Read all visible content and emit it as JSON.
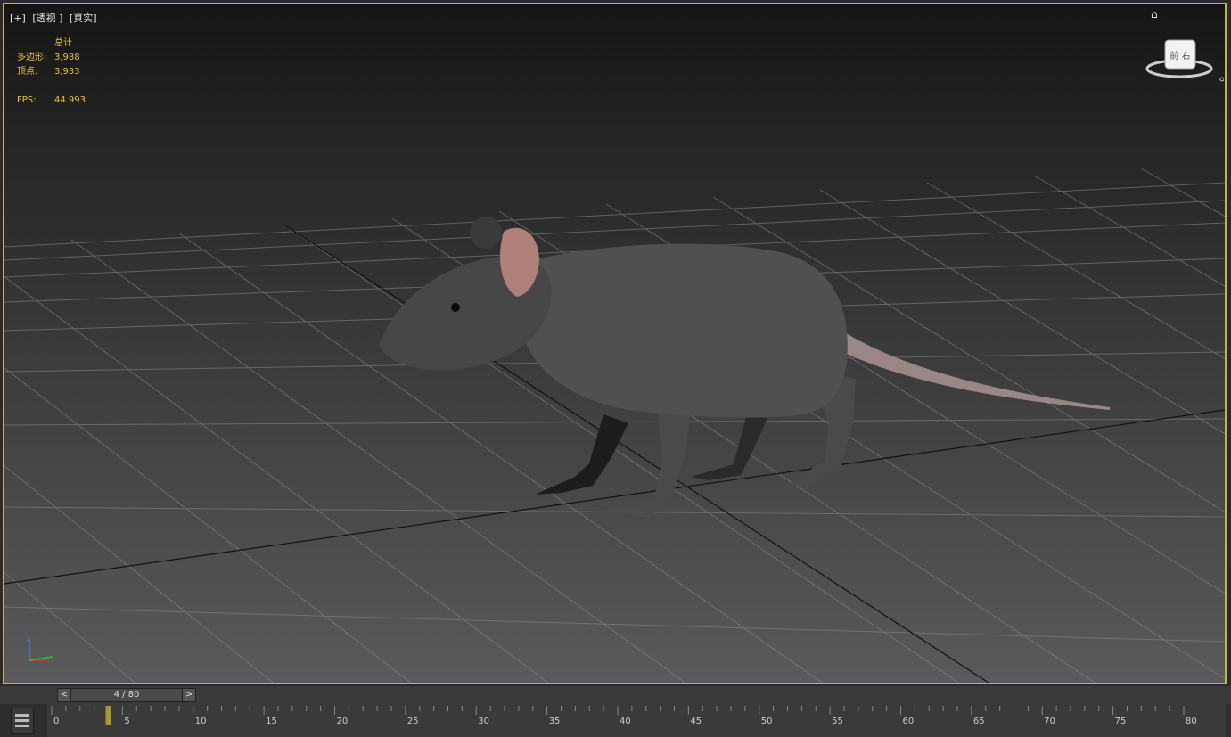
{
  "viewport": {
    "label_plus": "[+]",
    "label_view": "[透视 ]",
    "label_shading": "[真实]"
  },
  "stats": {
    "header": "总计",
    "polys_label": "多边形:",
    "polys_value": "3,988",
    "verts_label": "顶点:",
    "verts_value": "3,933",
    "fps_label": "FPS:",
    "fps_value": "44.993"
  },
  "viewcube": {
    "face_label": "前 右"
  },
  "axis": {
    "z_label": "z"
  },
  "timeslider": {
    "prev": "<",
    "next": ">",
    "frame_display": "4 / 80",
    "current_frame": 4,
    "total_frames": 80
  },
  "trackbar": {
    "ticks": [
      "0",
      "5",
      "10",
      "15",
      "20",
      "25",
      "30",
      "35",
      "40",
      "45",
      "50",
      "55",
      "60",
      "65",
      "70",
      "75",
      "80"
    ]
  },
  "colors": {
    "border": "#c9b04a",
    "stats": "#e8c43a",
    "thumb": "#a99a30"
  }
}
